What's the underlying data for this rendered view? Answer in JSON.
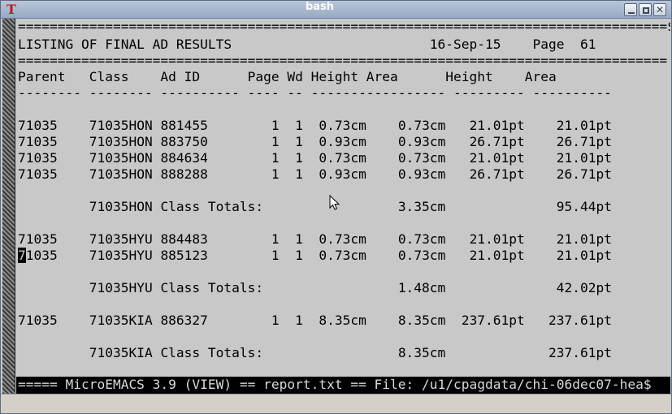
{
  "window": {
    "title": "bash",
    "app_icon": "xterm-icon",
    "controls": [
      "minimize-icon",
      "maximize-icon",
      "close-icon"
    ]
  },
  "terminal": {
    "separator_top": "==================================================================================$",
    "header": {
      "left": "LISTING OF FINAL AD RESULTS",
      "date": "16-Sep-15",
      "page_label": "Page",
      "page_number": "61"
    },
    "separator_header": "==================================================================================",
    "columns": [
      "Parent",
      "Class",
      "Ad ID",
      "Page",
      "Wd",
      "Height",
      "Area",
      "Height",
      "Area"
    ],
    "column_underline": "-------- -------- ---------- ---- -- ----------------- --------- ----------",
    "rows": [
      {
        "parent": "71035",
        "class": "71035HON",
        "ad_id": "881455",
        "page": "1",
        "wd": "1",
        "height_cm": "0.73cm",
        "area_cm": "0.73cm",
        "height_pt": "21.01pt",
        "area_pt": "21.01pt"
      },
      {
        "parent": "71035",
        "class": "71035HON",
        "ad_id": "883750",
        "page": "1",
        "wd": "1",
        "height_cm": "0.93cm",
        "area_cm": "0.93cm",
        "height_pt": "26.71pt",
        "area_pt": "26.71pt"
      },
      {
        "parent": "71035",
        "class": "71035HON",
        "ad_id": "884634",
        "page": "1",
        "wd": "1",
        "height_cm": "0.73cm",
        "area_cm": "0.73cm",
        "height_pt": "21.01pt",
        "area_pt": "21.01pt"
      },
      {
        "parent": "71035",
        "class": "71035HON",
        "ad_id": "888288",
        "page": "1",
        "wd": "1",
        "height_cm": "0.93cm",
        "area_cm": "0.93cm",
        "height_pt": "26.71pt",
        "area_pt": "26.71pt"
      },
      {
        "total_class": "71035HON",
        "label": "Class Totals:",
        "area_cm": "3.35cm",
        "area_pt": "95.44pt"
      },
      {
        "parent": "71035",
        "class": "71035HYU",
        "ad_id": "884483",
        "page": "1",
        "wd": "1",
        "height_cm": "0.73cm",
        "area_cm": "0.73cm",
        "height_pt": "21.01pt",
        "area_pt": "21.01pt"
      },
      {
        "parent": "71035",
        "class": "71035HYU",
        "ad_id": "885123",
        "page": "1",
        "wd": "1",
        "height_cm": "0.73cm",
        "area_cm": "0.73cm",
        "height_pt": "21.01pt",
        "area_pt": "21.01pt",
        "cursor": true
      },
      {
        "total_class": "71035HYU",
        "label": "Class Totals:",
        "area_cm": "1.48cm",
        "area_pt": "42.02pt"
      },
      {
        "parent": "71035",
        "class": "71035KIA",
        "ad_id": "886327",
        "page": "1",
        "wd": "1",
        "height_cm": "8.35cm",
        "area_cm": "8.35cm",
        "height_pt": "237.61pt",
        "area_pt": "237.61pt"
      },
      {
        "total_class": "71035KIA",
        "label": "Class Totals:",
        "area_cm": "8.35cm",
        "area_pt": "237.61pt"
      }
    ],
    "status_line": "===== MicroEMACS 3.9 (VIEW) == report.txt == File: /u1/cpagdata/chi-06dec07-hea$"
  },
  "pointer_icon": "mouse-pointer-icon",
  "colors": {
    "terminal_bg": "#c8c8c8",
    "text": "#000000",
    "titlebar": "#98aac4",
    "status_bg": "#000000"
  }
}
